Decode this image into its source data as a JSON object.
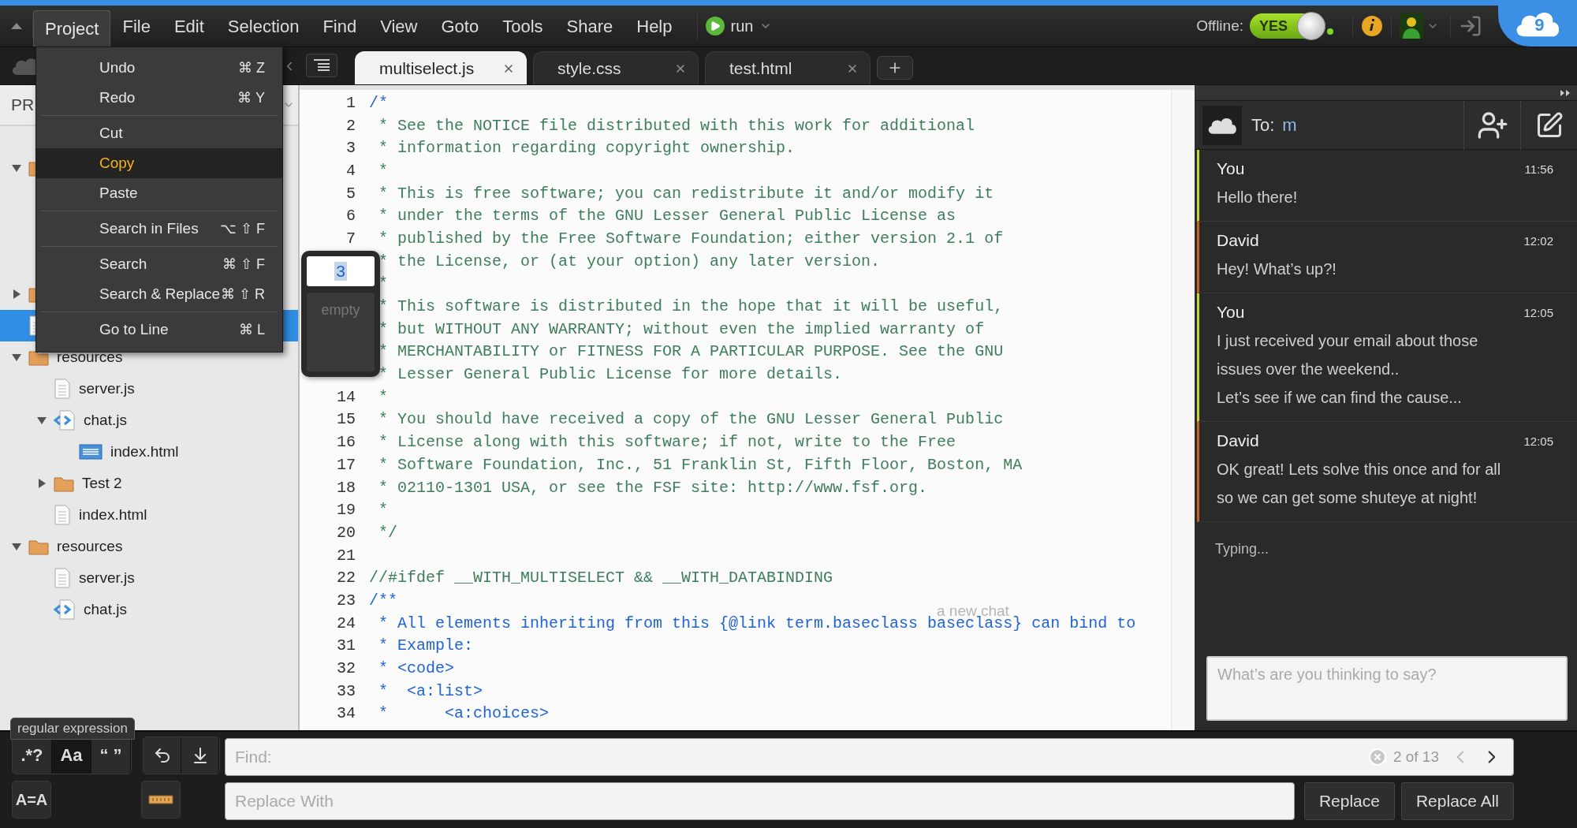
{
  "menu_bar": {
    "items": [
      {
        "label": "Project",
        "selected": true
      },
      {
        "label": "File",
        "selected": false
      },
      {
        "label": "Edit",
        "selected": false
      },
      {
        "label": "Selection",
        "selected": false
      },
      {
        "label": "Find",
        "selected": false
      },
      {
        "label": "View",
        "selected": false
      },
      {
        "label": "Goto",
        "selected": false
      },
      {
        "label": "Tools",
        "selected": false
      },
      {
        "label": "Share",
        "selected": false
      },
      {
        "label": "Help",
        "selected": false
      }
    ],
    "run_button": {
      "label": "run"
    }
  },
  "status": {
    "offline_label": "Offline:",
    "offline_toggle": {
      "label": "YES",
      "on": true
    }
  },
  "logo": {
    "text": "9"
  },
  "project_menu": {
    "groups": [
      {
        "items": [
          {
            "label": "Undo",
            "shortcut": "⌘ Z",
            "selected": false
          },
          {
            "label": "Redo",
            "shortcut": "⌘ Y",
            "selected": false
          }
        ]
      },
      {
        "items": [
          {
            "label": "Cut",
            "selected": false
          },
          {
            "label": "Copy",
            "selected": true
          },
          {
            "label": "Paste",
            "selected": false
          }
        ]
      },
      {
        "items": [
          {
            "label": "Search in Files",
            "shortcut": "⌥ ⇧ F",
            "selected": false
          }
        ]
      },
      {
        "items": [
          {
            "label": "Search",
            "shortcut": "⌘ ⇧ F",
            "selected": false
          },
          {
            "label": "Search & Replace",
            "shortcut": "⌘ ⇧ R",
            "selected": false
          }
        ]
      },
      {
        "items": [
          {
            "label": "Go to Line",
            "shortcut": "⌘ L",
            "selected": false
          }
        ]
      }
    ]
  },
  "tabs": [
    {
      "label": "multiselect.js",
      "selected": true
    },
    {
      "label": "style.css",
      "selected": false
    },
    {
      "label": "test.html",
      "selected": false
    }
  ],
  "sidebar": {
    "header": "PR",
    "tree": [
      {
        "kind": "folder",
        "expanded": true,
        "selected": false
      },
      {
        "kind": "folder",
        "expanded": false,
        "selected": false
      },
      {
        "kind": "file",
        "selected": true
      },
      {
        "kind": "folder",
        "label": "resources",
        "expanded": true,
        "selected": false,
        "children": [
          {
            "kind": "file",
            "label": "server.js",
            "selected": false
          },
          {
            "kind": "js",
            "label": "chat.js",
            "expanded": true,
            "selected": false,
            "children": [
              {
                "kind": "html",
                "label": "index.html",
                "selected": false
              }
            ]
          },
          {
            "kind": "folder",
            "label": "Test 2",
            "expanded": false,
            "selected": false
          },
          {
            "kind": "file",
            "label": "index.html",
            "selected": false
          }
        ]
      },
      {
        "kind": "folder",
        "label": "resources",
        "expanded": true,
        "selected": false,
        "children": [
          {
            "kind": "file",
            "label": "server.js",
            "selected": false
          },
          {
            "kind": "js",
            "label": "chat.js",
            "selected": false
          }
        ]
      }
    ]
  },
  "editor": {
    "lines": [
      {
        "number": "1",
        "kind": "doc",
        "text": "/*"
      },
      {
        "number": "2",
        "kind": "comment",
        "text": " * See the NOTICE file distributed with this work for additional"
      },
      {
        "number": "3",
        "kind": "comment",
        "text": " * information regarding copyright ownership."
      },
      {
        "number": "4",
        "kind": "comment",
        "text": " *"
      },
      {
        "number": "5",
        "kind": "comment",
        "text": " * This is free software; you can redistribute it and/or modify it"
      },
      {
        "number": "6",
        "kind": "comment",
        "text": " * under the terms of the GNU Lesser General Public License as"
      },
      {
        "number": "7",
        "kind": "comment",
        "text": " * published by the Free Software Foundation; either version 2.1 of"
      },
      {
        "kind": "comment",
        "text": " * the License, or (at your option) any later version."
      },
      {
        "kind": "comment",
        "text": " *"
      },
      {
        "kind": "comment",
        "text": " * This software is distributed in the hope that it will be useful,"
      },
      {
        "kind": "comment",
        "text": " * but WITHOUT ANY WARRANTY; without even the implied warranty of"
      },
      {
        "kind": "comment",
        "text": " * MERCHANTABILITY or FITNESS FOR A PARTICULAR PURPOSE. See the GNU"
      },
      {
        "kind": "comment",
        "text": " * Lesser General Public License for more details."
      },
      {
        "number": "14",
        "kind": "comment",
        "text": " *"
      },
      {
        "number": "15",
        "kind": "comment",
        "text": " * You should have received a copy of the GNU Lesser General Public"
      },
      {
        "number": "16",
        "kind": "comment",
        "text": " * License along with this software; if not, write to the Free"
      },
      {
        "number": "17",
        "kind": "comment",
        "text": " * Software Foundation, Inc., 51 Franklin St, Fifth Floor, Boston, MA"
      },
      {
        "number": "18",
        "kind": "comment",
        "text": " * 02110-1301 USA, or see the FSF site: http://www.fsf.org."
      },
      {
        "number": "19",
        "kind": "comment",
        "text": " *"
      },
      {
        "number": "20",
        "kind": "comment",
        "text": " */"
      },
      {
        "number": "21"
      },
      {
        "number": "22",
        "kind": "comment",
        "text": "//#ifdef __WITH_MULTISELECT && __WITH_DATABINDING"
      },
      {
        "number": "23",
        "kind": "doc",
        "text": "/**"
      },
      {
        "number": "24",
        "kind": "doc",
        "text": " * All elements inheriting from this {@link term.baseclass baseclass} can bind to"
      },
      {
        "number": "31",
        "kind": "doc",
        "text": " * Example:"
      },
      {
        "number": "32",
        "kind": "doc",
        "text": " * <code>"
      },
      {
        "number": "33",
        "kind": "doc",
        "text": " *  <a:list>"
      },
      {
        "number": "34",
        "kind": "doc",
        "text": " *      <a:choices>"
      }
    ],
    "goto_popup": {
      "value": "3",
      "hint": "empty"
    },
    "overlay_text": "a new chat"
  },
  "chat": {
    "to_label": "To:",
    "recipient": "m",
    "messages": [
      {
        "author": "You",
        "time": "11:56",
        "text": "Hello there!",
        "color": "#c9d43c"
      },
      {
        "author": "David",
        "time": "12:02",
        "text": "Hey! What’s up?!",
        "color": "#c2632c"
      },
      {
        "author": "You",
        "time": "12:05",
        "text": "I just received your email about those\nissues over the weekend..\nLet’s see if we can find the cause...",
        "color": "#c9d43c"
      },
      {
        "author": "David",
        "time": "12:05",
        "text": "OK great! Lets solve this once and for all\nso we can get some shuteye at night!",
        "color": "#c2632c"
      }
    ],
    "typing": "Typing...",
    "input": {
      "placeholder": "What’s are you thinking to say?"
    }
  },
  "find_bar": {
    "tooltip": "regular expression",
    "options": [
      {
        "label": ".*?",
        "on": false
      },
      {
        "label": "Aa",
        "on": true
      },
      {
        "label": "“ ”",
        "on": false
      }
    ],
    "font_toggle": "A=A",
    "find": {
      "placeholder": "Find:",
      "count": "2 of 13"
    },
    "replace": {
      "placeholder": "Replace With"
    },
    "buttons": [
      "Replace",
      "Replace All"
    ]
  }
}
